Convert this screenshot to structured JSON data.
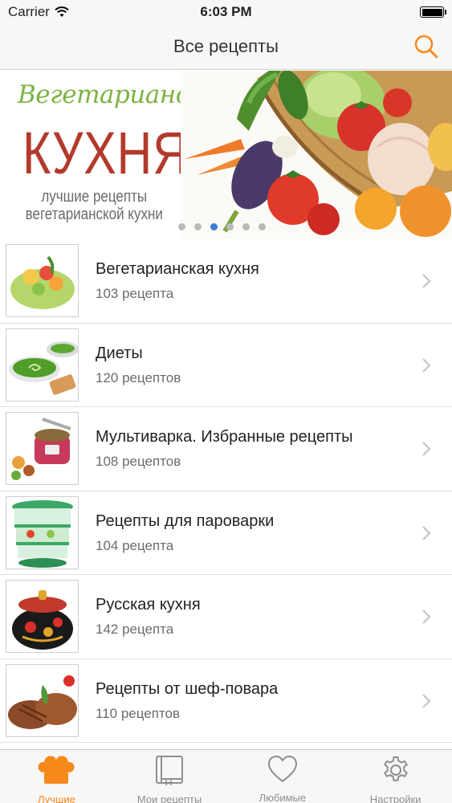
{
  "status_bar": {
    "carrier": "Carrier",
    "time": "6:03 PM",
    "battery_level": 1.0
  },
  "nav": {
    "title": "Все рецепты",
    "search_icon": "search-icon"
  },
  "banner": {
    "title_line1": "Вегетарианская",
    "title_line2": "КУХНЯ",
    "subtitle_line1": "лучшие рецепты",
    "subtitle_line2": "вегетарианской кухни",
    "page_count": 6,
    "active_page": 3
  },
  "categories": [
    {
      "title": "Вегетарианская кухня",
      "count": "103 рецепта",
      "image": "fruit-salad"
    },
    {
      "title": "Диеты",
      "count": "120 рецептов",
      "image": "green-soup"
    },
    {
      "title": "Мультиварка. Избранные рецепты",
      "count": "108 рецептов",
      "image": "multicooker"
    },
    {
      "title": "Рецепты для пароварки",
      "count": "104 рецепта",
      "image": "steamer"
    },
    {
      "title": "Русская кухня",
      "count": "142 рецепта",
      "image": "khokhloma-pot"
    },
    {
      "title": "Рецепты от шеф-повара",
      "count": "110 рецептов",
      "image": "grilled-meat"
    }
  ],
  "tabs": [
    {
      "label": "Лучшие",
      "icon": "chef-hat-icon",
      "active": true
    },
    {
      "label": "Мои рецепты",
      "icon": "book-icon",
      "active": false
    },
    {
      "label": "Любимые",
      "icon": "heart-icon",
      "active": false
    },
    {
      "label": "Настройки",
      "icon": "gear-icon",
      "active": false
    }
  ],
  "colors": {
    "accent": "#f7891b",
    "banner_green": "#7cb342",
    "banner_red": "#b23a2c",
    "page_dot_active": "#3b7fd3"
  }
}
